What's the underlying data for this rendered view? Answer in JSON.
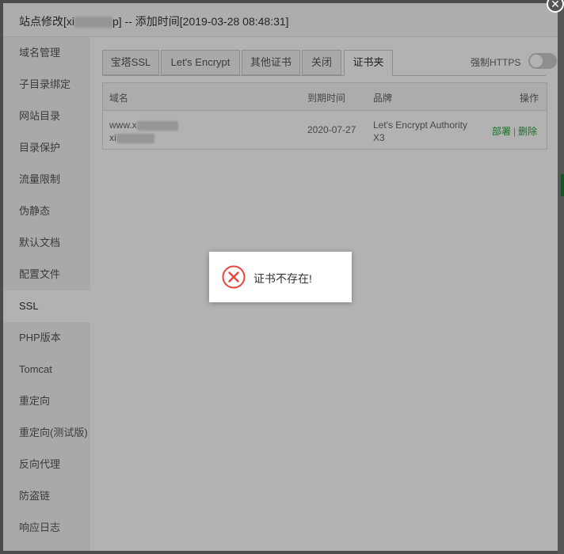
{
  "window": {
    "title_prefix": "站点修改[xi",
    "title_suffix": "p] -- 添加时间[2019-03-28 08:48:31]",
    "close_glyph": "✕"
  },
  "sidebar": {
    "items": [
      {
        "label": "域名管理"
      },
      {
        "label": "子目录绑定"
      },
      {
        "label": "网站目录"
      },
      {
        "label": "目录保护"
      },
      {
        "label": "流量限制"
      },
      {
        "label": "伪静态"
      },
      {
        "label": "默认文档"
      },
      {
        "label": "配置文件"
      },
      {
        "label": "SSL",
        "active": true
      },
      {
        "label": "PHP版本"
      },
      {
        "label": "Tomcat"
      },
      {
        "label": "重定向"
      },
      {
        "label": "重定向(测试版)"
      },
      {
        "label": "反向代理"
      },
      {
        "label": "防盗链"
      },
      {
        "label": "响应日志"
      }
    ]
  },
  "tabs": [
    {
      "label": "宝塔SSL"
    },
    {
      "label": "Let's Encrypt"
    },
    {
      "label": "其他证书"
    },
    {
      "label": "关闭"
    },
    {
      "label": "证书夹",
      "active": true
    }
  ],
  "https_toggle": {
    "label": "强制HTTPS",
    "on": false
  },
  "table": {
    "headers": {
      "domain": "域名",
      "expiry": "到期时间",
      "brand": "品牌",
      "actions": "操作"
    },
    "rows": [
      {
        "domain_line1": "www.x",
        "domain_line2": "xi",
        "expiry": "2020-07-27",
        "brand_line1": "Let's Encrypt Authority",
        "brand_line2": "X3",
        "deploy": "部署",
        "separator": "|",
        "delete": "删除"
      }
    ]
  },
  "message": {
    "text": "证书不存在!",
    "icon": "error-circle-icon"
  },
  "colors": {
    "accent": "#20a53a",
    "error": "#e6463c"
  }
}
